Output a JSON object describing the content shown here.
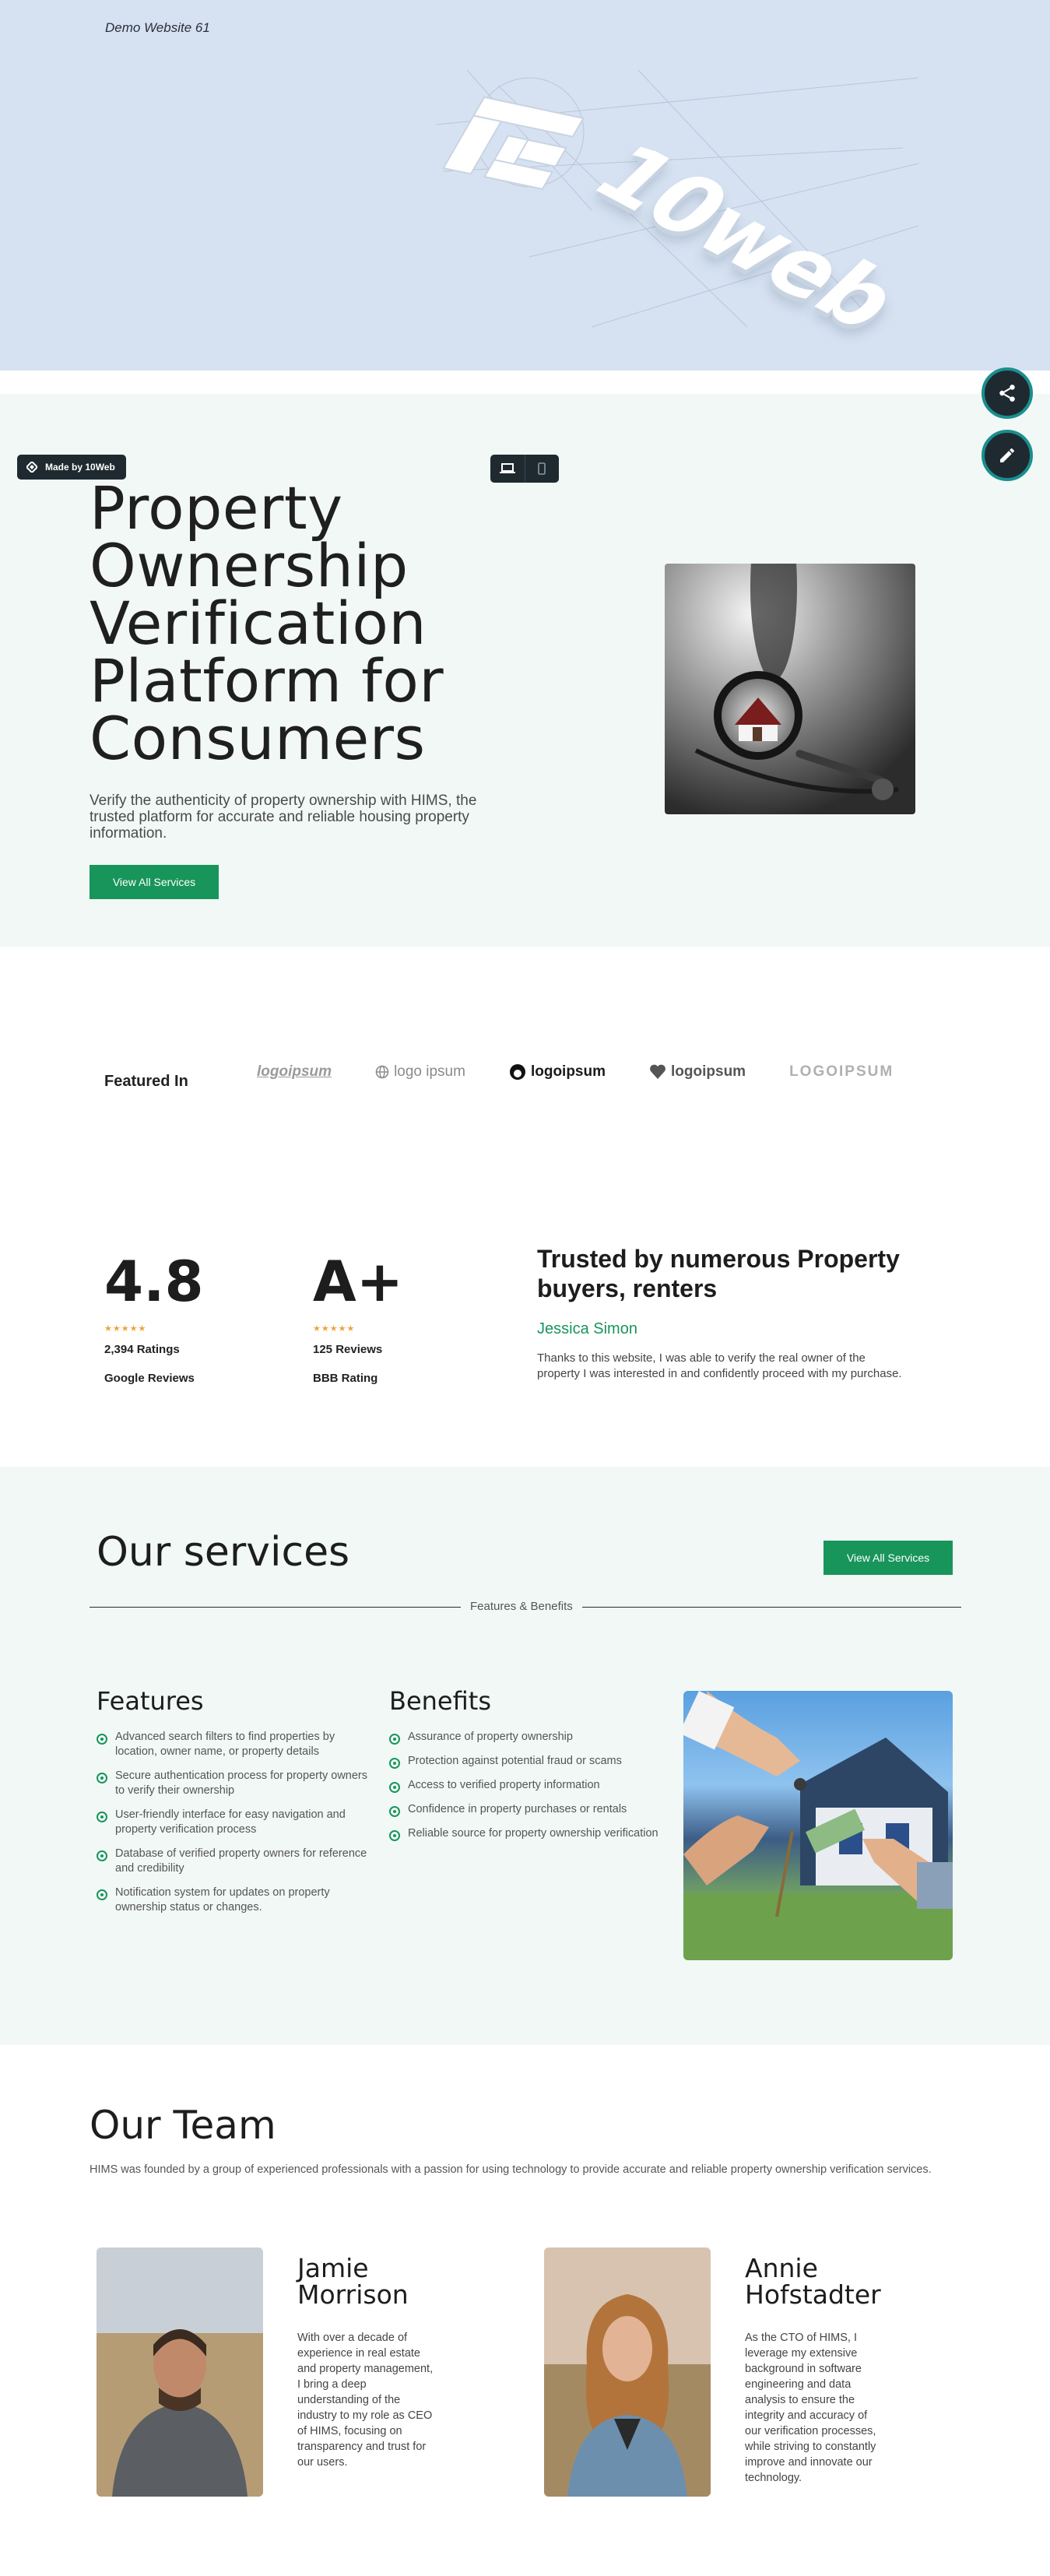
{
  "banner": {
    "demo_title": "Demo Website 61",
    "brand_text": "10web",
    "bg_color": "#d6e2f1"
  },
  "floating_actions": {
    "share_icon": "share-icon",
    "edit_icon": "pencil-icon"
  },
  "toolbar": {
    "made_by": "Made by 10Web",
    "desktop_icon": "laptop-icon",
    "mobile_icon": "phone-icon"
  },
  "hero": {
    "title": "Property Ownership Verification Platform for Consumers",
    "lead": "Verify the authenticity of property ownership with HIMS, the trusted platform for accurate and reliable housing property information.",
    "cta_label": "View All Services",
    "image_icon": "magnifier-house-key-photo"
  },
  "featured": {
    "label": "Featured In",
    "logos": [
      "logoipsum",
      "logo ipsum",
      "logoipsum",
      "logoipsum",
      "LOGOIPSUM"
    ]
  },
  "ratings": {
    "stats": [
      {
        "value": "4.8",
        "stars": "★★★★★",
        "count": "2,394 Ratings",
        "source": "Google Reviews"
      },
      {
        "value": "A+",
        "stars": "★★★★★",
        "count": "125 Reviews",
        "source": "BBB Rating"
      }
    ],
    "testimonial": {
      "heading": "Trusted by numerous Property buyers, renters",
      "author": "Jessica Simon",
      "quote": "Thanks to this website, I was able to verify the real owner of the property I was interested in and confidently proceed with my purchase."
    }
  },
  "services": {
    "title": "Our services",
    "cta_label": "View All Services",
    "divider_label": "Features & Benefits",
    "features": {
      "title": "Features",
      "items": [
        "Advanced search filters to find properties by location, owner name, or property details",
        "Secure authentication process for property owners to verify their ownership",
        "User-friendly interface for easy navigation and property verification process",
        "Database of verified property owners for reference and credibility",
        "Notification system for updates on property ownership status or changes."
      ]
    },
    "benefits": {
      "title": "Benefits",
      "items": [
        "Assurance of property ownership",
        "Protection against potential fraud or scams",
        "Access to verified property information",
        "Confidence in property purchases or rentals",
        "Reliable source for property ownership verification"
      ]
    },
    "accent_color": "#18955b"
  },
  "team": {
    "title": "Our Team",
    "intro": "HIMS was founded by a group of experienced professionals with a passion for using technology to provide accurate and reliable property ownership verification services.",
    "members": [
      {
        "name": "Jamie Morrison",
        "bio": "With over a decade of experience in real estate and property management, I bring a deep understanding of the industry to my role as CEO of HIMS, focusing on transparency and trust for our users."
      },
      {
        "name": "Annie Hofstadter",
        "bio": "As the CTO of HIMS, I leverage my extensive background in software engineering and data analysis to ensure the integrity and accuracy of our verification processes, while striving to constantly improve and innovate our technology."
      }
    ]
  }
}
